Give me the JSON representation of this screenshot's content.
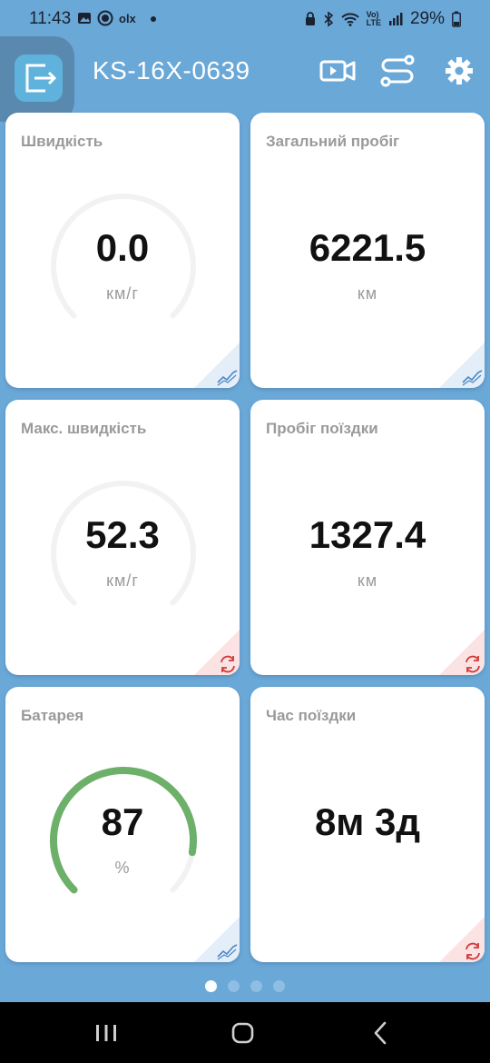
{
  "status_bar": {
    "time": "11:43",
    "battery_percent": "29%",
    "lte_label": "LTE"
  },
  "header": {
    "title": "KS-16X-0639",
    "icons": [
      "exit-icon",
      "video-icon",
      "route-icon",
      "settings-icon"
    ]
  },
  "cards": [
    {
      "title": "Швидкість",
      "value": "0.0",
      "unit": "км/г",
      "gauge_level": 0,
      "corner": "chart-icon"
    },
    {
      "title": "Загальний пробіг",
      "value": "6221.5",
      "unit": "км",
      "corner": "chart-icon"
    },
    {
      "title": "Макс. швидкість",
      "value": "52.3",
      "unit": "км/г",
      "gauge_level": 0,
      "corner": "reset-icon"
    },
    {
      "title": "Пробіг поїздки",
      "value": "1327.4",
      "unit": "км",
      "corner": "reset-icon"
    },
    {
      "title": "Батарея",
      "value": "87",
      "unit": "%",
      "gauge_level": 0.87,
      "corner": "chart-icon"
    },
    {
      "title": "Час поїздки",
      "value": "8м 3д",
      "corner": "reset-icon"
    }
  ],
  "pager": {
    "pages": 4,
    "active": 0
  },
  "colors": {
    "background": "#6aa8d8",
    "gauge_track": "#f2f2f2",
    "gauge_fill": "#6db06a",
    "chart_corner": "#e3eef8",
    "reset_corner": "#fbe3e3"
  }
}
